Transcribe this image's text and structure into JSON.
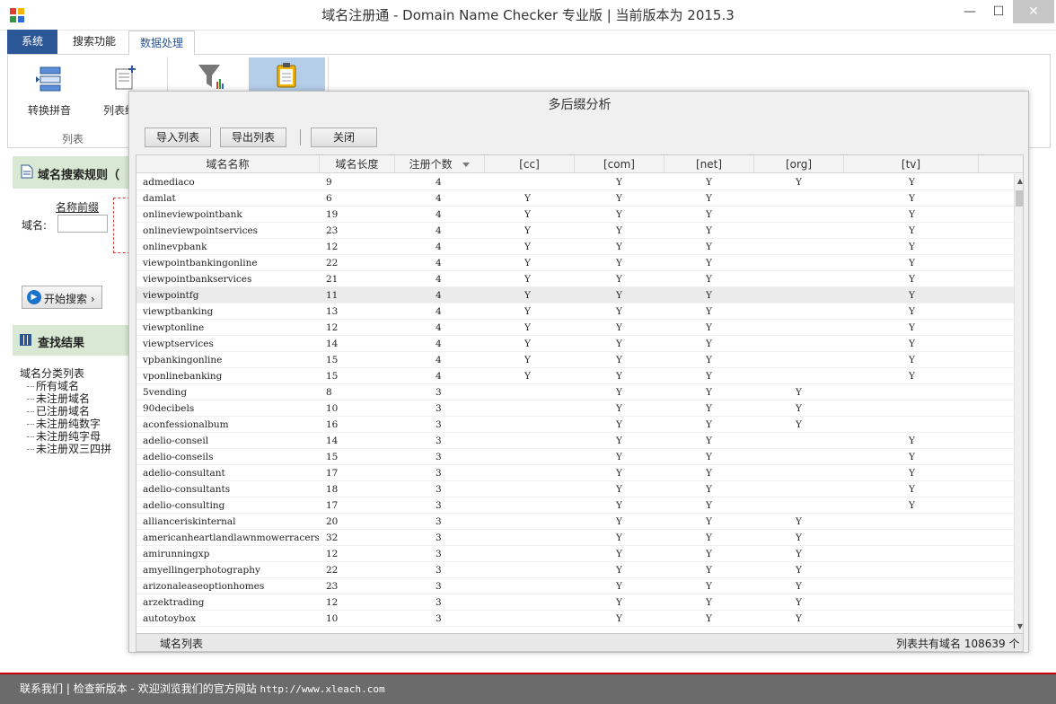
{
  "window": {
    "title": "域名注册通 - Domain Name Checker 专业版 | 当前版本为 2015.3",
    "minimize": "—",
    "maximize": "☐",
    "close": "✕"
  },
  "ribbon": {
    "tabs": [
      "系统",
      "搜索功能",
      "数据处理"
    ],
    "buttons": [
      {
        "label": "转换拼音",
        "icon": "convert-pinyin-icon"
      },
      {
        "label": "列表统",
        "icon": "list-stats-icon"
      },
      {
        "label": "",
        "icon": "filter-icon"
      },
      {
        "label": "",
        "icon": "clipboard-icon"
      }
    ],
    "group_label": "列表"
  },
  "left_panel": {
    "rules_title": "域名搜索规则（",
    "prefix_label": "名称前缀",
    "domain_label": "域名:",
    "start_search": "开始搜索 ›",
    "results_title": "查找结果",
    "tree_root": "域名分类列表",
    "tree_items": [
      "所有域名",
      "未注册域名",
      "已注册域名",
      "未注册纯数字",
      "未注册纯字母",
      "未注册双三四拼"
    ]
  },
  "status_bar": {
    "contact": "联系我们",
    "check_update": "检查新版本",
    "welcome": "- 欢迎浏览我们的官方网站",
    "url": "http://www.xleach.com"
  },
  "dialog": {
    "title": "多后缀分析",
    "buttons": {
      "import": "导入列表",
      "export": "导出列表",
      "close": "关闭"
    },
    "columns": [
      "域名名称",
      "域名长度",
      "注册个数",
      "[cc]",
      "[com]",
      "[net]",
      "[org]",
      "[tv]"
    ],
    "sort_column": "注册个数",
    "mark": "Y",
    "rows": [
      {
        "name": "admediaco",
        "len": "9",
        "count": "4",
        "cc": "",
        "com": "Y",
        "net": "Y",
        "org": "Y",
        "tv": "Y"
      },
      {
        "name": "damlat",
        "len": "6",
        "count": "4",
        "cc": "Y",
        "com": "Y",
        "net": "Y",
        "org": "",
        "tv": "Y"
      },
      {
        "name": "onlineviewpointbank",
        "len": "19",
        "count": "4",
        "cc": "Y",
        "com": "Y",
        "net": "Y",
        "org": "",
        "tv": "Y"
      },
      {
        "name": "onlineviewpointservices",
        "len": "23",
        "count": "4",
        "cc": "Y",
        "com": "Y",
        "net": "Y",
        "org": "",
        "tv": "Y"
      },
      {
        "name": "onlinevpbank",
        "len": "12",
        "count": "4",
        "cc": "Y",
        "com": "Y",
        "net": "Y",
        "org": "",
        "tv": "Y"
      },
      {
        "name": "viewpointbankingonline",
        "len": "22",
        "count": "4",
        "cc": "Y",
        "com": "Y",
        "net": "Y",
        "org": "",
        "tv": "Y"
      },
      {
        "name": "viewpointbankservices",
        "len": "21",
        "count": "4",
        "cc": "Y",
        "com": "Y",
        "net": "Y",
        "org": "",
        "tv": "Y"
      },
      {
        "name": "viewpointfg",
        "len": "11",
        "count": "4",
        "cc": "Y",
        "com": "Y",
        "net": "Y",
        "org": "",
        "tv": "Y"
      },
      {
        "name": "viewptbanking",
        "len": "13",
        "count": "4",
        "cc": "Y",
        "com": "Y",
        "net": "Y",
        "org": "",
        "tv": "Y"
      },
      {
        "name": "viewptonline",
        "len": "12",
        "count": "4",
        "cc": "Y",
        "com": "Y",
        "net": "Y",
        "org": "",
        "tv": "Y"
      },
      {
        "name": "viewptservices",
        "len": "14",
        "count": "4",
        "cc": "Y",
        "com": "Y",
        "net": "Y",
        "org": "",
        "tv": "Y"
      },
      {
        "name": "vpbankingonline",
        "len": "15",
        "count": "4",
        "cc": "Y",
        "com": "Y",
        "net": "Y",
        "org": "",
        "tv": "Y"
      },
      {
        "name": "vponlinebanking",
        "len": "15",
        "count": "4",
        "cc": "Y",
        "com": "Y",
        "net": "Y",
        "org": "",
        "tv": "Y"
      },
      {
        "name": "5vending",
        "len": "8",
        "count": "3",
        "cc": "",
        "com": "Y",
        "net": "Y",
        "org": "Y",
        "tv": ""
      },
      {
        "name": "90decibels",
        "len": "10",
        "count": "3",
        "cc": "",
        "com": "Y",
        "net": "Y",
        "org": "Y",
        "tv": ""
      },
      {
        "name": "aconfessionalbum",
        "len": "16",
        "count": "3",
        "cc": "",
        "com": "Y",
        "net": "Y",
        "org": "Y",
        "tv": ""
      },
      {
        "name": "adelio-conseil",
        "len": "14",
        "count": "3",
        "cc": "",
        "com": "Y",
        "net": "Y",
        "org": "",
        "tv": "Y"
      },
      {
        "name": "adelio-conseils",
        "len": "15",
        "count": "3",
        "cc": "",
        "com": "Y",
        "net": "Y",
        "org": "",
        "tv": "Y"
      },
      {
        "name": "adelio-consultant",
        "len": "17",
        "count": "3",
        "cc": "",
        "com": "Y",
        "net": "Y",
        "org": "",
        "tv": "Y"
      },
      {
        "name": "adelio-consultants",
        "len": "18",
        "count": "3",
        "cc": "",
        "com": "Y",
        "net": "Y",
        "org": "",
        "tv": "Y"
      },
      {
        "name": "adelio-consulting",
        "len": "17",
        "count": "3",
        "cc": "",
        "com": "Y",
        "net": "Y",
        "org": "",
        "tv": "Y"
      },
      {
        "name": "allianceriskinternal",
        "len": "20",
        "count": "3",
        "cc": "",
        "com": "Y",
        "net": "Y",
        "org": "Y",
        "tv": ""
      },
      {
        "name": "americanheartlandlawnmowerracers",
        "len": "32",
        "count": "3",
        "cc": "",
        "com": "Y",
        "net": "Y",
        "org": "Y",
        "tv": ""
      },
      {
        "name": "amirunningxp",
        "len": "12",
        "count": "3",
        "cc": "",
        "com": "Y",
        "net": "Y",
        "org": "Y",
        "tv": ""
      },
      {
        "name": "amyellingerphotography",
        "len": "22",
        "count": "3",
        "cc": "",
        "com": "Y",
        "net": "Y",
        "org": "Y",
        "tv": ""
      },
      {
        "name": "arizonaleaseoptionhomes",
        "len": "23",
        "count": "3",
        "cc": "",
        "com": "Y",
        "net": "Y",
        "org": "Y",
        "tv": ""
      },
      {
        "name": "arzektrading",
        "len": "12",
        "count": "3",
        "cc": "",
        "com": "Y",
        "net": "Y",
        "org": "Y",
        "tv": ""
      },
      {
        "name": "autotoybox",
        "len": "10",
        "count": "3",
        "cc": "",
        "com": "Y",
        "net": "Y",
        "org": "Y",
        "tv": ""
      },
      {
        "name": "",
        "len": "",
        "count": "",
        "cc": "",
        "com": "",
        "net": "",
        "org": "",
        "tv": ""
      }
    ],
    "selected_row": 7,
    "footer_left": "域名列表",
    "footer_right": "列表共有域名 108639 个"
  }
}
